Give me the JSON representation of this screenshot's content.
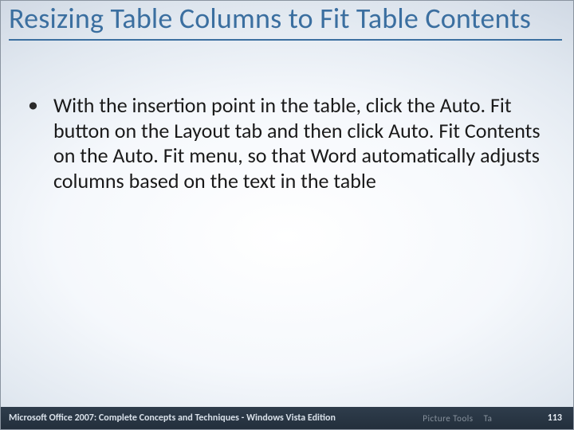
{
  "slide": {
    "title": "Resizing Table Columns to Fit Table Contents",
    "bullets": [
      "With the insertion point in the table, click the Auto. Fit button on the Layout tab and then click Auto. Fit Contents on the Auto. Fit menu, so that Word automatically adjusts columns based on the text in the table"
    ]
  },
  "footer": {
    "left": "Microsoft Office 2007: Complete Concepts and Techniques - Windows Vista Edition",
    "ghost_a": "",
    "ghost_b": "Picture Tools",
    "ghost_c": "Ta",
    "page_number": "113"
  }
}
